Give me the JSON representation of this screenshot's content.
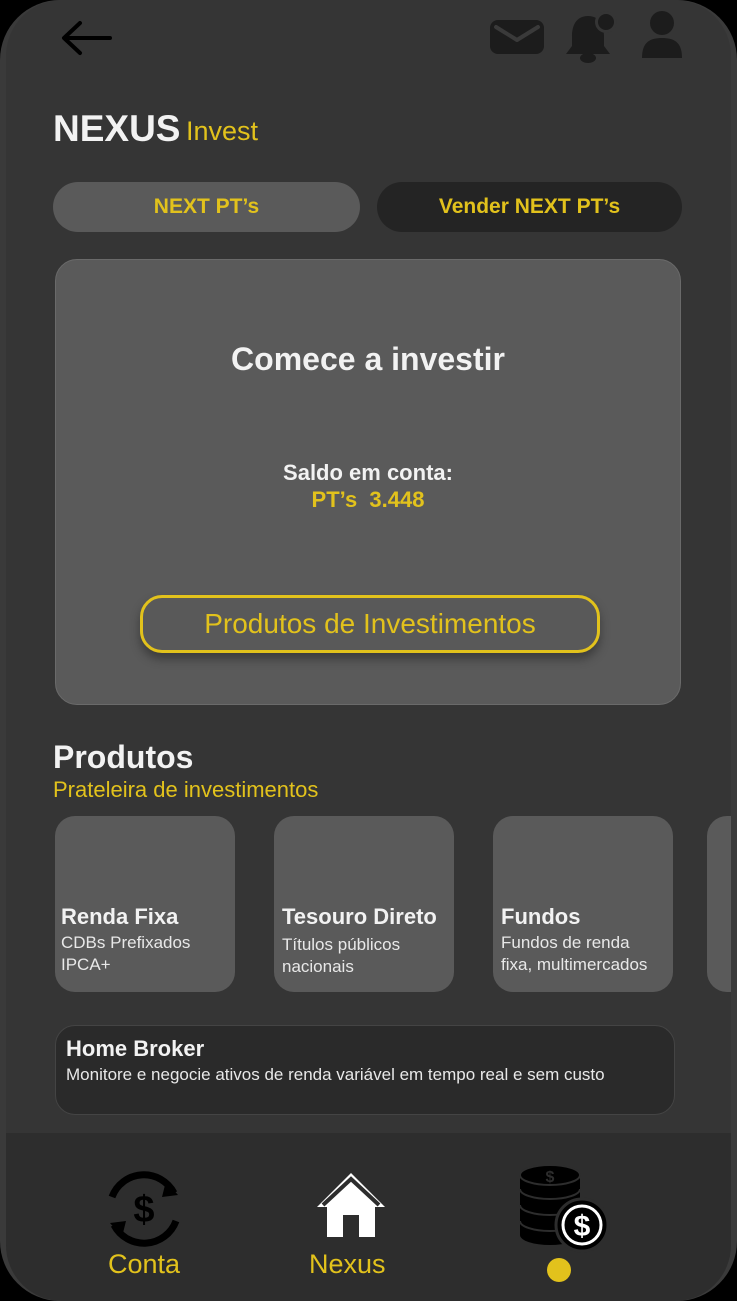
{
  "header": {
    "brand_main": "NEXUS",
    "brand_sub": "Invest",
    "icons": [
      "back-arrow-icon",
      "mail-icon",
      "bell-icon",
      "user-icon"
    ]
  },
  "tabs": [
    {
      "label": "NEXT PT’s",
      "active": true
    },
    {
      "label": "Vender NEXT PT’s",
      "active": false
    }
  ],
  "hero": {
    "title": "Comece a investir",
    "balance_label": "Saldo em conta:",
    "balance_value": "PT’s  3.448",
    "cta_label": "Produtos de Investimentos"
  },
  "products": {
    "title": "Produtos",
    "subtitle": "Prateleira de investimentos",
    "items": [
      {
        "title": "Renda Fixa",
        "line1": "CDBs Prefixados",
        "line2": "IPCA+"
      },
      {
        "title": "Tesouro Direto",
        "line1": "Títulos públicos",
        "line2": "nacionais"
      },
      {
        "title": "Fundos",
        "line1": "Fundos de renda",
        "line2": "fixa, multimercados"
      }
    ]
  },
  "home_broker": {
    "title": "Home Broker",
    "description": "Monitore e negocie ativos de renda variável em tempo real e sem custo"
  },
  "bottom_nav": {
    "items": [
      {
        "label": "Conta",
        "icon": "dollar-cycle-icon"
      },
      {
        "label": "Nexus",
        "icon": "home-icon"
      },
      {
        "label": "",
        "icon": "coins-icon",
        "active_dot": true
      }
    ]
  },
  "colors": {
    "accent": "#e2c21c",
    "background": "#353535",
    "card": "#5a5a5a",
    "nav": "#2d2d2d"
  }
}
